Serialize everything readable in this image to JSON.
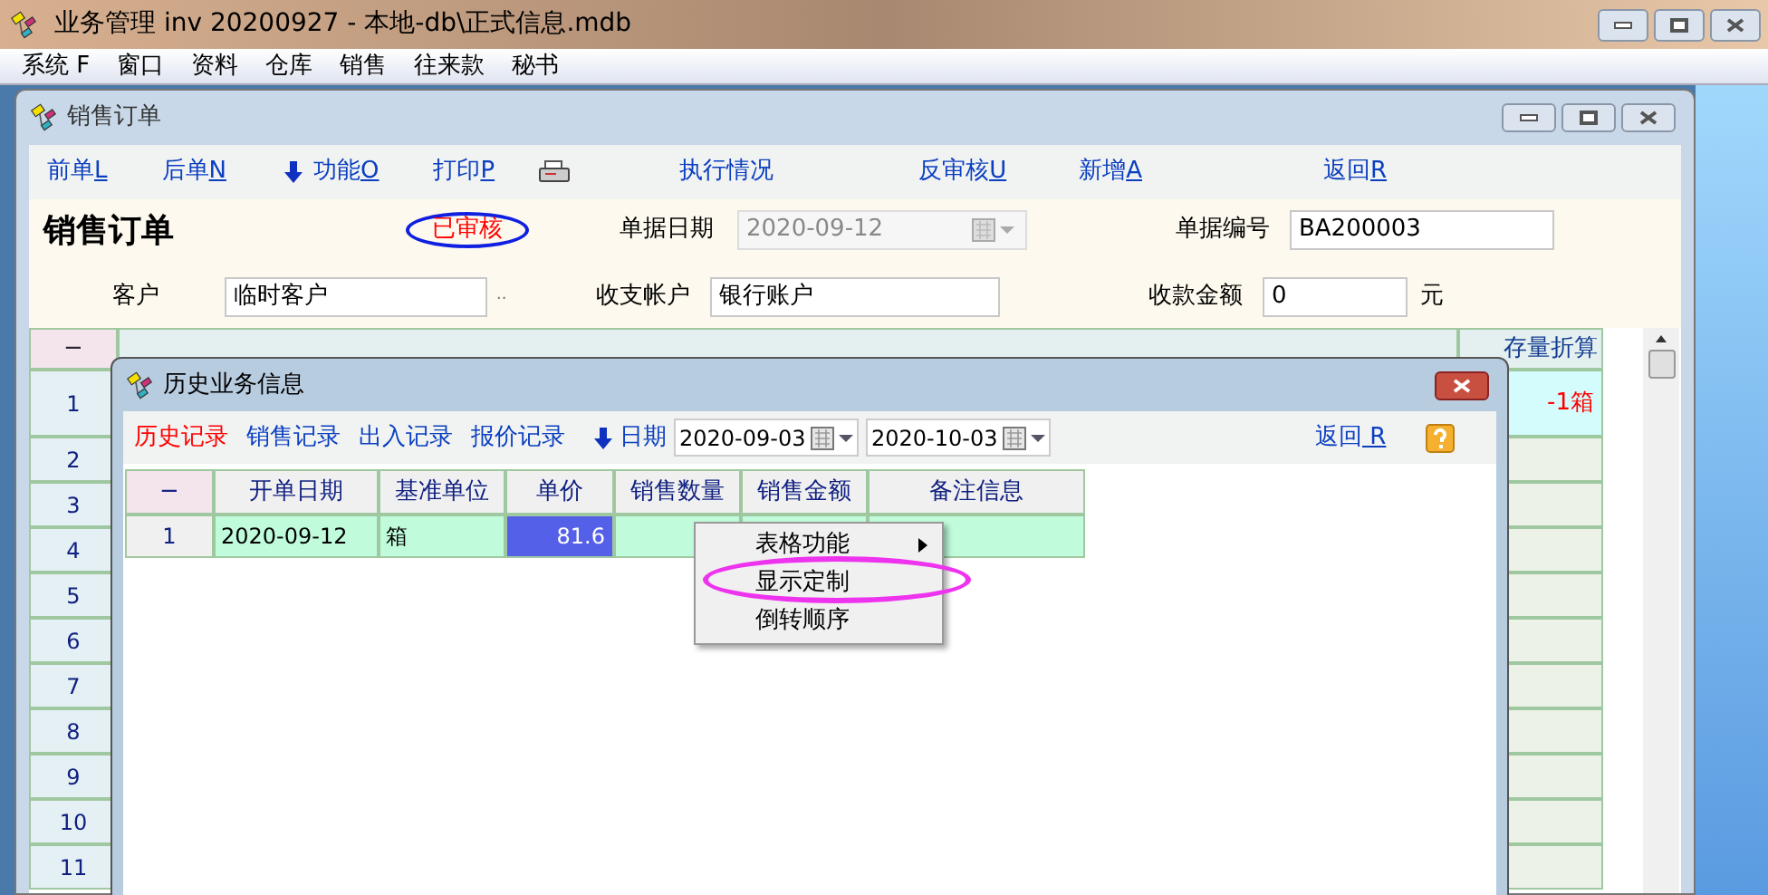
{
  "app_title": "业务管理 inv 20200927 - 本地-db\\正式信息.mdb",
  "menu": [
    "系统 F",
    "窗口",
    "资料",
    "仓库",
    "销售",
    "往来款",
    "秘书"
  ],
  "order_window": {
    "title": "销售订单",
    "toolbar": [
      {
        "kind": "link",
        "label": "前单",
        "key": "L"
      },
      {
        "kind": "link",
        "label": "后单",
        "key": "N"
      },
      {
        "kind": "arrow",
        "label": "功能",
        "key": "O"
      },
      {
        "kind": "link",
        "label": "打印",
        "key": "P"
      },
      {
        "kind": "printer"
      },
      {
        "kind": "link",
        "label": "执行情况"
      },
      {
        "kind": "link",
        "label": "反审核",
        "key": "U"
      },
      {
        "kind": "link",
        "label": "新增",
        "key": "A"
      },
      {
        "kind": "link",
        "label": "返回",
        "key": "R"
      }
    ],
    "heading": "销售订单",
    "status": "已审核",
    "date_field": {
      "label": "单据日期",
      "value": "2020-09-12",
      "disabled": true
    },
    "number_field": {
      "label": "单据编号",
      "value": "BA200003"
    },
    "customer_field": {
      "label": "客户",
      "value": "临时客户",
      "suffix": ".."
    },
    "account_field": {
      "label": "收支帐户",
      "value": "银行账户"
    },
    "amount_field": {
      "label": "收款金额",
      "value": "0",
      "unit": "元"
    },
    "grid": {
      "corner": "−",
      "last_column": "存量折算",
      "rows": [
        {
          "number": "1",
          "last": "-1箱",
          "selected": true
        },
        {
          "number": "2",
          "selected": false
        },
        {
          "number": "3",
          "selected": false
        },
        {
          "number": "4",
          "selected": false
        },
        {
          "number": "5",
          "selected": false
        },
        {
          "number": "6",
          "selected": false
        },
        {
          "number": "7",
          "selected": false
        },
        {
          "number": "8",
          "selected": false
        },
        {
          "number": "9",
          "selected": false
        },
        {
          "number": "10",
          "selected": false
        },
        {
          "number": "11",
          "selected": false
        }
      ]
    }
  },
  "dialog": {
    "title": "历史业务信息",
    "tabs": [
      {
        "label": "历史记录",
        "selected": true
      },
      {
        "label": "销售记录",
        "selected": false
      },
      {
        "label": "出入记录",
        "selected": false
      },
      {
        "label": "报价记录",
        "selected": false
      }
    ],
    "date_label": "日期",
    "date_from": "2020-09-03",
    "date_to": "2020-10-03",
    "back": {
      "label": "返回",
      "key": "R"
    },
    "table": {
      "columns": [
        "−",
        "开单日期",
        "基准单位",
        "单价",
        "销售数量",
        "销售金额",
        "备注信息"
      ],
      "rows": [
        {
          "cells": [
            {
              "text": "1",
              "selected": false
            },
            {
              "text": "2020-09-12",
              "selected": false
            },
            {
              "text": "箱",
              "selected": false
            },
            {
              "text": "81.6",
              "selected": true
            }
          ]
        }
      ]
    }
  },
  "context_menu": [
    {
      "label": "表格功能",
      "submenu": true,
      "circled": false
    },
    {
      "label": "显示定制",
      "submenu": false,
      "circled": true
    },
    {
      "label": "倒转顺序",
      "submenu": false,
      "circled": false
    }
  ]
}
